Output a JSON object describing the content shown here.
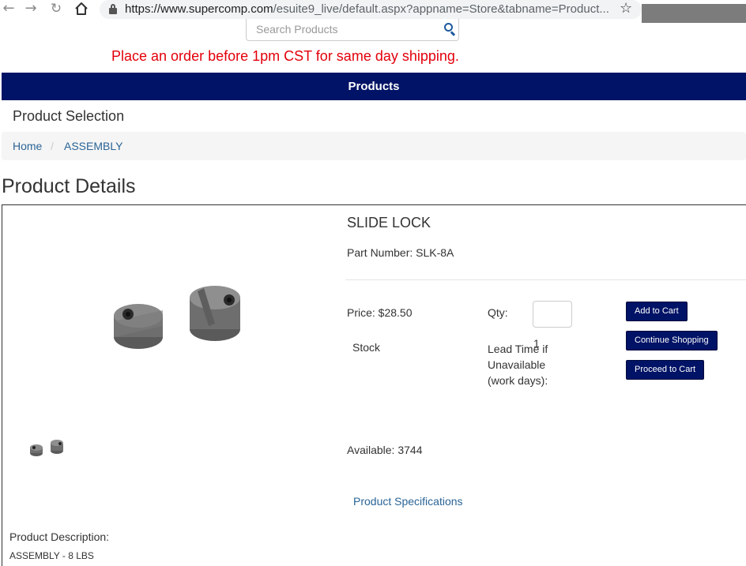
{
  "browser": {
    "url_host": "https://www.supercomp.com",
    "url_path": "/esuite9_live/default.aspx?appname=Store&tabname=Product..."
  },
  "search": {
    "placeholder": "Search Products"
  },
  "shipping_notice": "Place an order before 1pm CST for same day shipping.",
  "nav": {
    "products_label": "Products"
  },
  "section_title": "Product Selection",
  "breadcrumb": {
    "home": "Home",
    "separator": "/",
    "category": "ASSEMBLY"
  },
  "page_heading": "Product Details",
  "product": {
    "name": "SLIDE LOCK",
    "part_number_label": "Part Number: SLK-8A",
    "price_label": "Price: $28.50",
    "qty_label": "Qty:",
    "stock_label": "Stock",
    "lead_time_label": "Lead Time if Unavailable (work days):",
    "lead_time_value": "1",
    "available_label": "Available: 3744",
    "spec_link": "Product Specifications",
    "description_label": "Product Description:",
    "description_text": "ASSEMBLY - 8 LBS"
  },
  "buttons": {
    "add_to_cart": "Add to Cart",
    "continue_shopping": "Continue Shopping",
    "proceed_to_cart": "Proceed to Cart"
  },
  "colors": {
    "nav_bar": "#001366",
    "notice_red": "#e3000b",
    "link_blue": "#2a6496"
  }
}
